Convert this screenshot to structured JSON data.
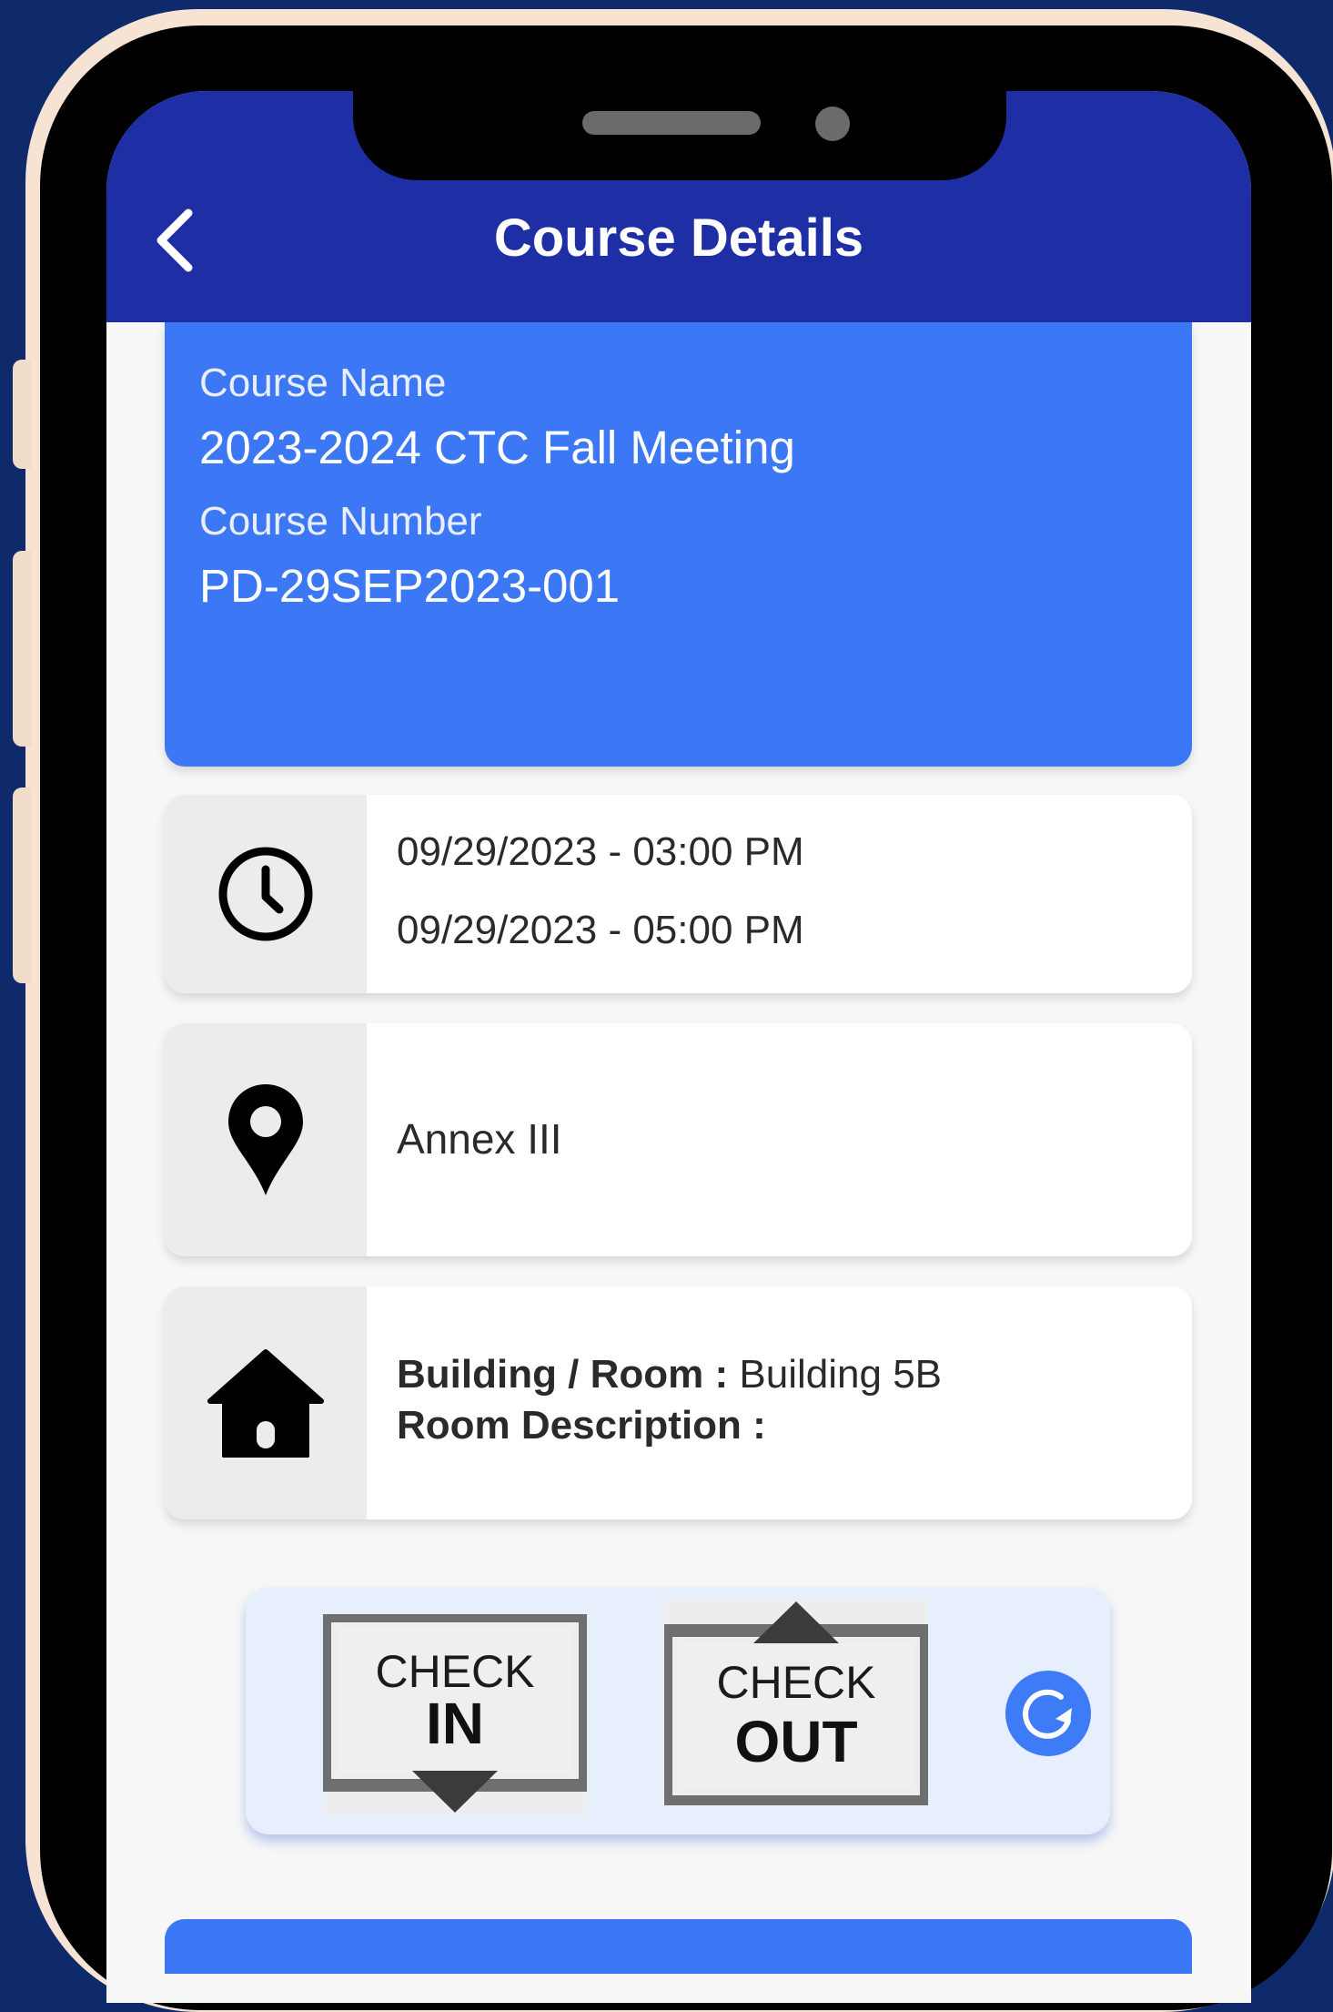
{
  "header": {
    "title": "Course Details",
    "back_icon": "chevron-left-icon"
  },
  "course": {
    "name_label": "Course Name",
    "name": "2023-2024 CTC Fall Meeting",
    "number_label": "Course Number",
    "number": "PD-29SEP2023-001"
  },
  "schedule": {
    "icon": "clock-icon",
    "start": "09/29/2023 - 03:00 PM",
    "end": "09/29/2023 - 05:00 PM"
  },
  "location": {
    "icon": "map-pin-icon",
    "name": "Annex III"
  },
  "room": {
    "icon": "home-icon",
    "building_label": "Building / Room :",
    "building_value": "Building 5B",
    "description_label": "Room Description :",
    "description_value": ""
  },
  "actions": {
    "check_in_line1": "CHECK",
    "check_in_line2": "IN",
    "check_out_line1": "CHECK",
    "check_out_line2": "OUT",
    "refresh_icon": "refresh-icon"
  },
  "colors": {
    "header": "#1e2fa6",
    "card": "#3c78f6",
    "background": "#0e2a6b"
  }
}
